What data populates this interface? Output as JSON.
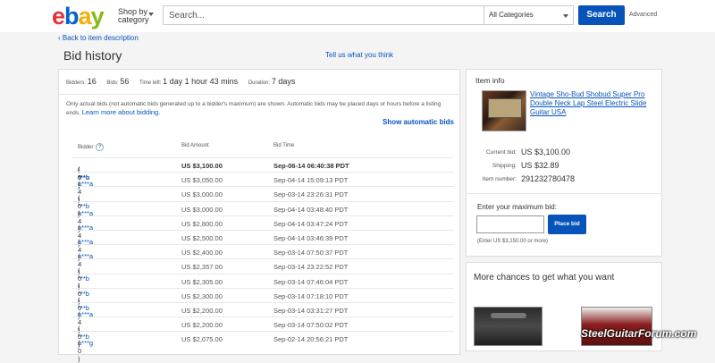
{
  "header": {
    "logo": {
      "e": "e",
      "b": "b",
      "a": "a",
      "y": "y"
    },
    "shop_by_line1": "Shop by",
    "shop_by_line2": "category",
    "search_placeholder": "Search...",
    "category_value": "All Categories",
    "search_button": "Search",
    "advanced_link": "Advanced"
  },
  "nav": {
    "back_link": "‹ Back to item description",
    "page_title": "Bid history",
    "feedback_link": "Tell us what you think"
  },
  "stats": {
    "bidders_label": "Bidders:",
    "bidders_value": "16",
    "bids_label": "Bids:",
    "bids_value": "56",
    "time_left_label": "Time left:",
    "time_left_value": "1 day 1 hour 43 mins",
    "duration_label": "Duration:",
    "duration_value": "7 days"
  },
  "note": {
    "text": "Only actual bids (not automatic bids generated up to a bidder's maximum) are shown. Automatic bids may be placed days or hours before a listing ends.",
    "link": "Learn more about bidding."
  },
  "show_automatic_bids": "Show automatic bids",
  "table": {
    "headers": {
      "bidder": "Bidder",
      "help": "?",
      "amount": "Bid Amount",
      "time": "Bid Time"
    },
    "rows": [
      {
        "bidder": "-***b",
        "score": "( 0 )",
        "amount": "US $3,100.00",
        "time": "Sep-06-14 06:40:38 PDT"
      },
      {
        "bidder": "a***a",
        "score": "( 4 )",
        "amount": "US $3,050.00",
        "time": "Sep-04-14 15:09:13 PDT"
      },
      {
        "bidder": "-***b",
        "score": "( 0 )",
        "amount": "US $3,000.00",
        "time": "Sep-03-14 23:26:31 PDT"
      },
      {
        "bidder": "a***a",
        "score": "( 4 )",
        "amount": "US $3,000.00",
        "time": "Sep-04-14 03:48:40 PDT"
      },
      {
        "bidder": "a***a",
        "score": "( 4 )",
        "amount": "US $2,800.00",
        "time": "Sep-04-14 03:47:24 PDT"
      },
      {
        "bidder": "a***a",
        "score": "( 4 )",
        "amount": "US $2,500.00",
        "time": "Sep-04-14 03:46:39 PDT"
      },
      {
        "bidder": "a***a",
        "score": "( 4 )",
        "amount": "US $2,400.00",
        "time": "Sep-03-14 07:50:37 PDT"
      },
      {
        "bidder": "-***b",
        "score": "( 0 )",
        "amount": "US $2,357.00",
        "time": "Sep-03-14 23:22:52 PDT"
      },
      {
        "bidder": "-***b",
        "score": "( 0 )",
        "amount": "US $2,305.00",
        "time": "Sep-03-14 07:46:04 PDT"
      },
      {
        "bidder": "-***b",
        "score": "( 0 )",
        "amount": "US $2,300.00",
        "time": "Sep-03-14 07:18:10 PDT"
      },
      {
        "bidder": "a***a",
        "score": "( 4 )",
        "amount": "US $2,200.00",
        "time": "Sep-03-14 03:31:27 PDT"
      },
      {
        "bidder": "-***b",
        "score": "( 0 )",
        "amount": "US $2,200.00",
        "time": "Sep-03-14 07:50:02 PDT"
      },
      {
        "bidder": "a***g",
        "score": "( 0 )",
        "amount": "US $2,075.00",
        "time": "Sep-02-14 20:56:21 PDT"
      }
    ]
  },
  "item_info": {
    "heading": "Item info",
    "title": "Vintage Sho-Bud Shobud Super Pro Double Neck Lap Steel Electric Slide Guitar USA",
    "current_bid_label": "Current bid:",
    "current_bid_value": "US $3,100.00",
    "shipping_label": "Shipping:",
    "shipping_value": "US $32.89",
    "item_number_label": "Item number:",
    "item_number_value": "291232780478"
  },
  "bid_box": {
    "label": "Enter your maximum bid:",
    "button": "Place bid",
    "hint": "(Enter US $3,150.00 or more)"
  },
  "more_chances": "More chances to get what you want",
  "watermark": "SteelGuitarForum.com",
  "colors": {
    "link": "#0654ba",
    "button": "#0654ba"
  }
}
